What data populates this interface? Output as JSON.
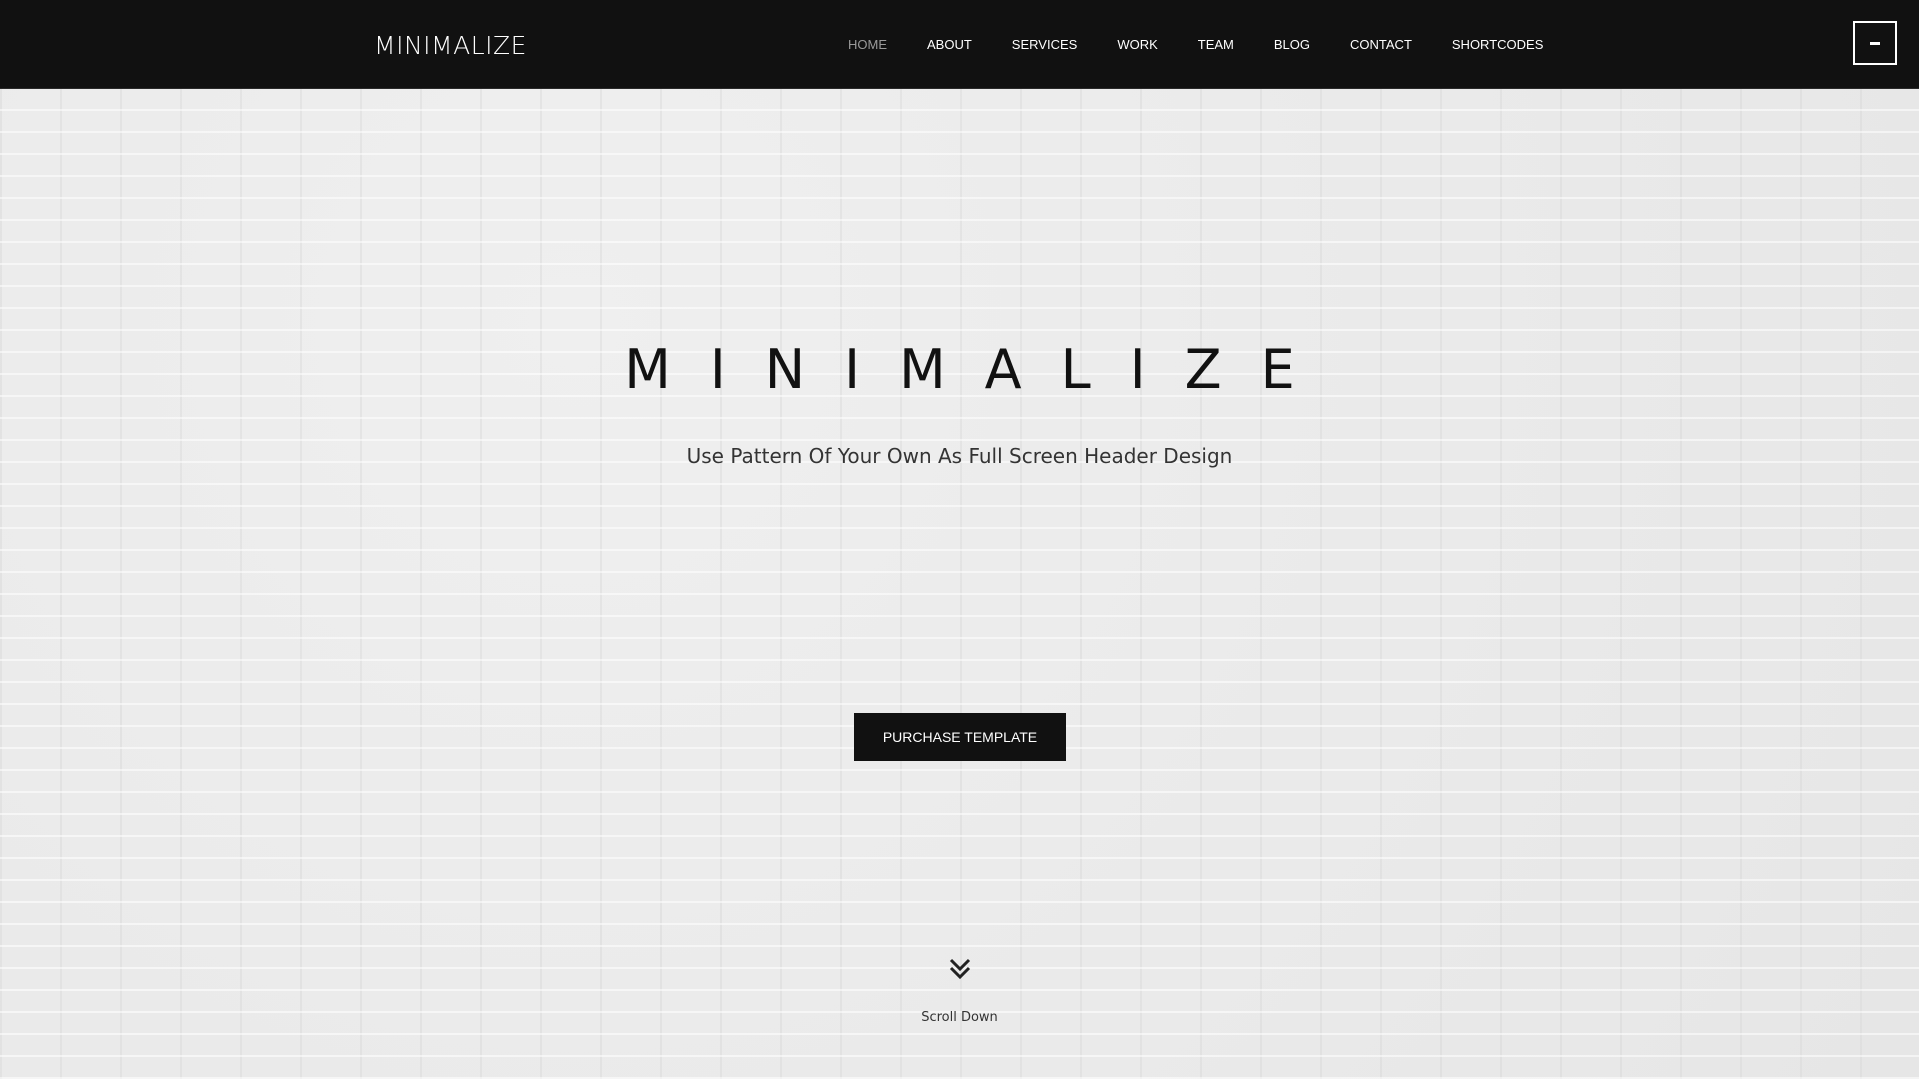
{
  "navbar": {
    "brand": "MINIMALIZE",
    "items": [
      {
        "label": "HOME",
        "active": true
      },
      {
        "label": "ABOUT",
        "active": false
      },
      {
        "label": "SERVICES",
        "active": false
      },
      {
        "label": "WORK",
        "active": false
      },
      {
        "label": "TEAM",
        "active": false
      },
      {
        "label": "BLOG",
        "active": false
      },
      {
        "label": "CONTACT",
        "active": false
      },
      {
        "label": "SHORTCODES",
        "active": false
      }
    ],
    "menu_toggle_icon": "minus-icon"
  },
  "hero": {
    "title": "MINIMALIZE",
    "subtitle": "Use Pattern Of Your Own As Full Screen Header Design",
    "cta_label": "PURCHASE TEMPLATE",
    "scroll_icon": "double-chevron-down-icon",
    "scroll_label": "Scroll Down"
  },
  "colors": {
    "navbar_bg": "#111111",
    "accent": "#111111",
    "active_nav": "#9a9a9a",
    "background": "#e9e9e9"
  }
}
